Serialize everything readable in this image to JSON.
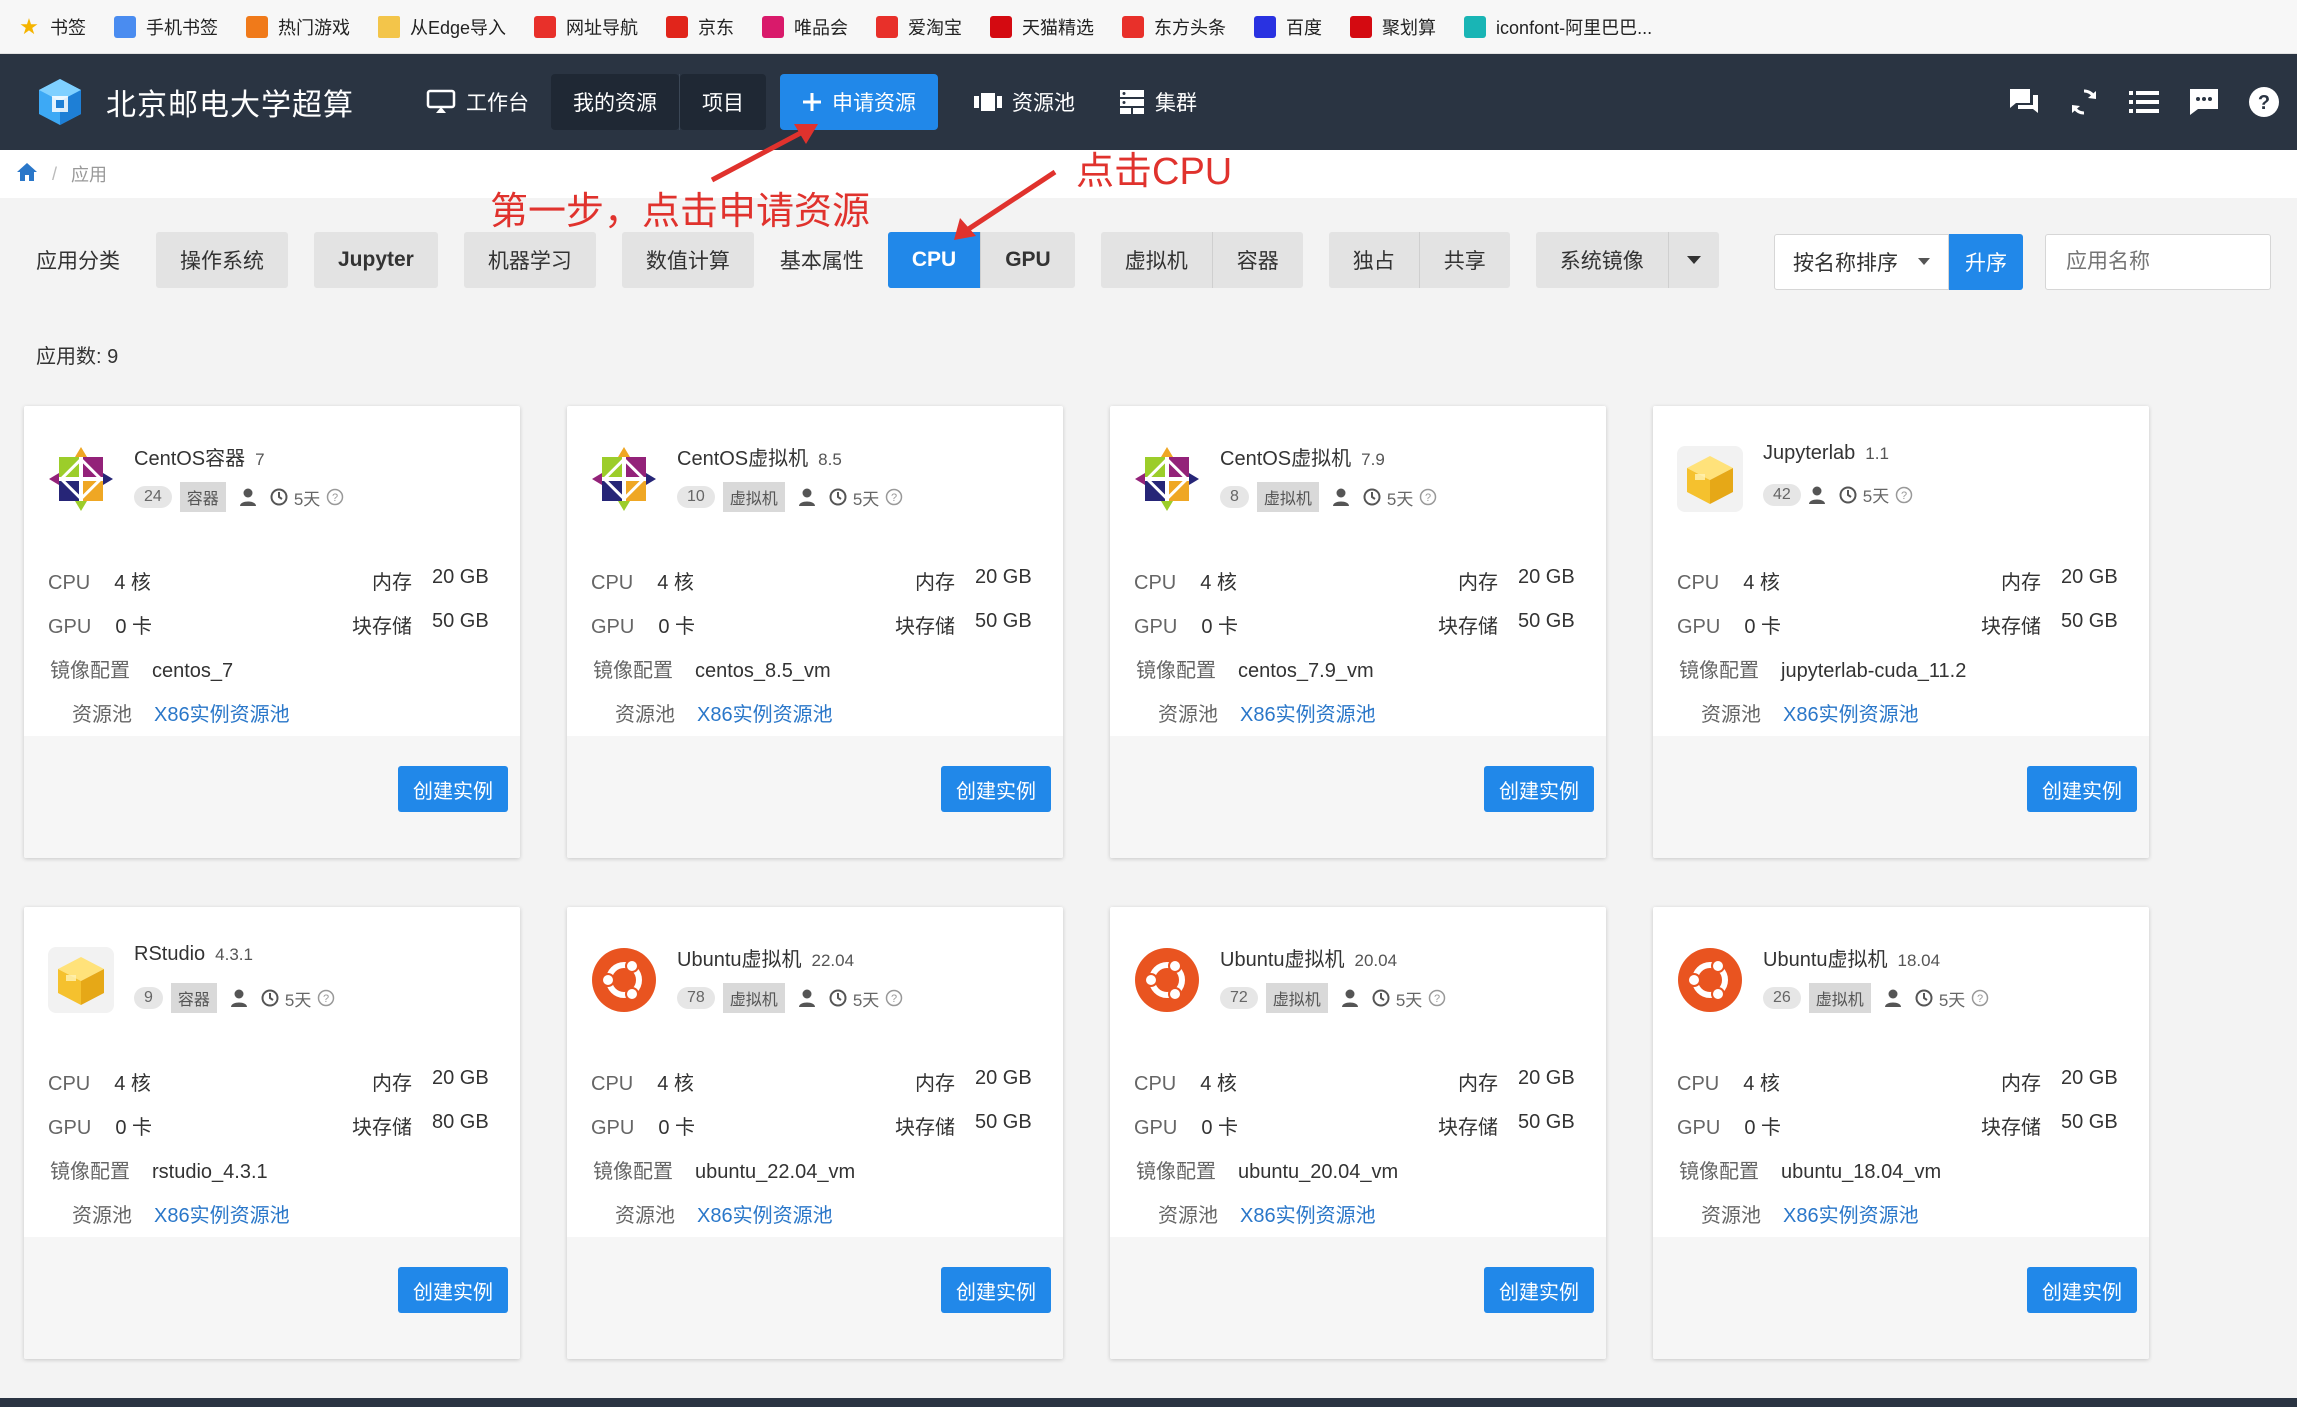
{
  "bookmarks": [
    {
      "label": "书签",
      "icon": "star-icon",
      "color": "#f5b400"
    },
    {
      "label": "手机书签",
      "icon": "phone-icon",
      "color": "#4a8cf0"
    },
    {
      "label": "热门游戏",
      "icon": "game-icon",
      "color": "#f07a1a"
    },
    {
      "label": "从Edge导入",
      "icon": "folder-icon",
      "color": "#f3c54a"
    },
    {
      "label": "网址导航",
      "icon": "nav-icon",
      "color": "#e8302a"
    },
    {
      "label": "京东",
      "icon": "jd-icon",
      "color": "#e1251b"
    },
    {
      "label": "唯品会",
      "icon": "vip-icon",
      "color": "#d91a6b"
    },
    {
      "label": "爱淘宝",
      "icon": "taobao-icon",
      "color": "#e8302a"
    },
    {
      "label": "天猫精选",
      "icon": "tmall-icon",
      "color": "#d40a11"
    },
    {
      "label": "东方头条",
      "icon": "news-icon",
      "color": "#e8302a"
    },
    {
      "label": "百度",
      "icon": "baidu-icon",
      "color": "#2932e1"
    },
    {
      "label": "聚划算",
      "icon": "juhuasuan-icon",
      "color": "#d40a11"
    },
    {
      "label": "iconfont-阿里巴巴...",
      "icon": "iconfont-icon",
      "color": "#19b5b5"
    }
  ],
  "nav": {
    "brand": "北京邮电大学超算",
    "workbench": "工作台",
    "my_resources": "我的资源",
    "projects": "项目",
    "apply": "申请资源",
    "pool": "资源池",
    "cluster": "集群"
  },
  "breadcrumb": {
    "current": "应用"
  },
  "filters": {
    "category_label": "应用分类",
    "os": "操作系统",
    "jupyter": "Jupyter",
    "ml": "机器学习",
    "numeric": "数值计算",
    "basic_attr": "基本属性",
    "cpu": "CPU",
    "gpu": "GPU",
    "vm": "虚拟机",
    "container": "容器",
    "exclusive": "独占",
    "shared": "共享",
    "image": "系统镜像",
    "sort": "按名称排序",
    "asc": "升序",
    "search_placeholder": "应用名称"
  },
  "app_count": "应用数: 9",
  "labels": {
    "cpu": "CPU",
    "gpu": "GPU",
    "mem": "内存",
    "storage": "块存储",
    "image": "镜像配置",
    "pool": "资源池",
    "days": "5天",
    "create": "创建实例"
  },
  "apps": [
    {
      "name": "CentOS容器",
      "version": "7",
      "count": "24",
      "type": "容器",
      "logo": "centos-logo",
      "cpu": "4 核",
      "gpu": "0 卡",
      "mem": "20 GB",
      "storage": "50 GB",
      "image": "centos_7",
      "pool": "X86实例资源池"
    },
    {
      "name": "CentOS虚拟机",
      "version": "8.5",
      "count": "10",
      "type": "虚拟机",
      "logo": "centos-logo",
      "cpu": "4 核",
      "gpu": "0 卡",
      "mem": "20 GB",
      "storage": "50 GB",
      "image": "centos_8.5_vm",
      "pool": "X86实例资源池"
    },
    {
      "name": "CentOS虚拟机",
      "version": "7.9",
      "count": "8",
      "type": "虚拟机",
      "logo": "centos-logo",
      "cpu": "4 核",
      "gpu": "0 卡",
      "mem": "20 GB",
      "storage": "50 GB",
      "image": "centos_7.9_vm",
      "pool": "X86实例资源池"
    },
    {
      "name": "Jupyterlab",
      "version": "1.1",
      "count": "42",
      "type": "",
      "logo": "box-logo",
      "cpu": "4 核",
      "gpu": "0 卡",
      "mem": "20 GB",
      "storage": "50 GB",
      "image": "jupyterlab-cuda_11.2",
      "pool": "X86实例资源池"
    },
    {
      "name": "RStudio",
      "version": "4.3.1",
      "count": "9",
      "type": "容器",
      "logo": "box-logo",
      "cpu": "4 核",
      "gpu": "0 卡",
      "mem": "20 GB",
      "storage": "80 GB",
      "image": "rstudio_4.3.1",
      "pool": "X86实例资源池"
    },
    {
      "name": "Ubuntu虚拟机",
      "version": "22.04",
      "count": "78",
      "type": "虚拟机",
      "logo": "ubuntu-logo",
      "cpu": "4 核",
      "gpu": "0 卡",
      "mem": "20 GB",
      "storage": "50 GB",
      "image": "ubuntu_22.04_vm",
      "pool": "X86实例资源池"
    },
    {
      "name": "Ubuntu虚拟机",
      "version": "20.04",
      "count": "72",
      "type": "虚拟机",
      "logo": "ubuntu-logo",
      "cpu": "4 核",
      "gpu": "0 卡",
      "mem": "20 GB",
      "storage": "50 GB",
      "image": "ubuntu_20.04_vm",
      "pool": "X86实例资源池"
    },
    {
      "name": "Ubuntu虚拟机",
      "version": "18.04",
      "count": "26",
      "type": "虚拟机",
      "logo": "ubuntu-logo",
      "cpu": "4 核",
      "gpu": "0 卡",
      "mem": "20 GB",
      "storage": "50 GB",
      "image": "ubuntu_18.04_vm",
      "pool": "X86实例资源池"
    }
  ],
  "annotations": {
    "step1": "第一步，点击申请资源",
    "click_cpu": "点击CPU"
  },
  "colors": {
    "primary": "#2188e9",
    "nav_bg": "#2a3442",
    "annotation": "#e0322d",
    "link": "#2a77c9"
  }
}
